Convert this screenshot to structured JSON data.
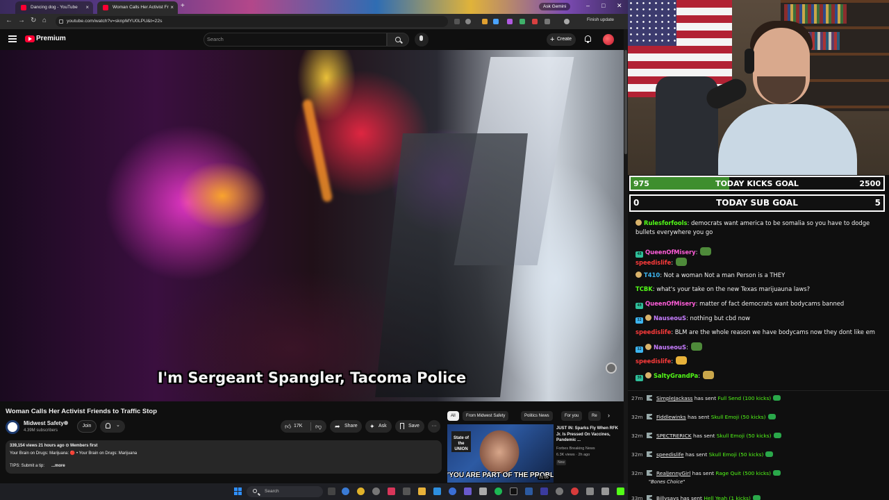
{
  "browser": {
    "tabs": [
      {
        "label": "Dancing dog - YouTube"
      },
      {
        "label": "Woman Calls Her Activist Fr"
      }
    ],
    "ask_gemini": "Ask Gemini",
    "url": "youtube.com/watch?v=sknpMYU0LPU&t=22s",
    "finish_update": "Finish update"
  },
  "youtube": {
    "logo_text": "Premium",
    "search_placeholder": "Search",
    "create_label": "Create",
    "subtitle": "I'm Sergeant Spangler, Tacoma Police",
    "video_title": "Woman Calls Her Activist Friends to Traffic Stop",
    "channel": {
      "name": "Midwest Safety",
      "subscribers": "4.39M subscribers",
      "join_label": "Join"
    },
    "actions": {
      "likes": "17K",
      "share": "Share",
      "ask": "Ask",
      "save": "Save",
      "more": "···"
    },
    "description": {
      "stats": "339,154 views  21 hours ago  ⊙ Members first",
      "line1": "Your Brain on Drugs: Marijuana:  🔴 • Your Brain on Drugs: Marijuana",
      "line2": "TIPS: Submit a tip:",
      "more": "...more"
    },
    "chips": [
      {
        "label": "All",
        "active": true
      },
      {
        "label": "From Midwest Safety"
      },
      {
        "label": "Politics News"
      },
      {
        "label": "For you"
      },
      {
        "label": "Re"
      }
    ],
    "recommendation": {
      "thumb_logo": "State of the UNION",
      "thumb_caption": "'YOU ARE PART OF THE PROBLEM!'",
      "duration": "21:05",
      "title": "JUST IN: Sparks Fly When RFK Jr. Is Pressed On Vaccines, Pandemic ...",
      "channel": "Forbes Breaking News",
      "meta": "6.3K views · 2h ago",
      "badge": "New"
    }
  },
  "taskbar": {
    "search_label": "Search"
  },
  "stream": {
    "kicks_goal": {
      "current": "975",
      "label": "TODAY KICKS GOAL",
      "target": "2500",
      "progress": 0.39
    },
    "sub_goal": {
      "current": "0",
      "label": "TODAY SUB GOAL",
      "target": "5"
    },
    "chat": [
      {
        "user": "Rulesforfools",
        "color": "#53fc18",
        "badges": [
          "gift"
        ],
        "text": ": democrats want america to be somalia so you have to dodge bullets everywhere you go"
      },
      {
        "user": "QueenOfMisery",
        "color": "#ff5dd9",
        "badges": [
          "sub"
        ],
        "sub_months": "48",
        "text": ":",
        "emote": "pepe"
      },
      {
        "user": "speedislife",
        "color": "#ff3b3b",
        "badges": [],
        "text": ":",
        "emote": "pepe"
      },
      {
        "user": "T410",
        "color": "#3db5f0",
        "badges": [
          "gift"
        ],
        "text": ": Not a woman Not a man Person is a THEY"
      },
      {
        "user": "TCBK",
        "color": "#53fc18",
        "badges": [],
        "text": ": what's your take on the new Texas marijuauna laws?"
      },
      {
        "user": "QueenOfMisery",
        "color": "#ff5dd9",
        "badges": [
          "sub"
        ],
        "sub_months": "48",
        "text": ": matter of fact democrats want bodycams banned"
      },
      {
        "user": "NauseouS",
        "color": "#c77dff",
        "badges": [
          "sub2",
          "gift"
        ],
        "sub_months": "32",
        "text": ": nothing but cbd now"
      },
      {
        "user": "speedislife",
        "color": "#ff3b3b",
        "badges": [],
        "text": ": BLM are the whole reason we have bodycams now they dont like em"
      },
      {
        "user": "NauseouS",
        "color": "#c77dff",
        "badges": [
          "sub2",
          "gift"
        ],
        "sub_months": "32",
        "text": ":",
        "emote": "pepe"
      },
      {
        "user": "speedislife",
        "color": "#ff3b3b",
        "badges": [],
        "text": ":",
        "emote": "think"
      },
      {
        "user": "SaltyGrandPa",
        "color": "#53fc18",
        "badges": [
          "sub",
          "gift"
        ],
        "sub_months": "36",
        "text": ":",
        "emote": "sword"
      }
    ],
    "events": [
      {
        "time": "27m",
        "user": "SimpleJackass",
        "verb": "has sent",
        "item": "Full Send (100 kicks)"
      },
      {
        "time": "32m",
        "user": "Fiddlewinks",
        "verb": "has sent",
        "item": "Skull Emoji (50 kicks)"
      },
      {
        "time": "32m",
        "user": "SPECTRERICK",
        "verb": "has sent",
        "item": "Skull Emoji (50 kicks)"
      },
      {
        "time": "32m",
        "user": "speedislife",
        "verb": "has sent",
        "item": "Skull Emoji (50 kicks)"
      },
      {
        "time": "32m",
        "user": "RealJennyGirl",
        "verb": "has sent",
        "item": "Rage Quit (500 kicks)",
        "quote": "\"Bones Choice\""
      },
      {
        "time": "33m",
        "user": "Billysays",
        "verb": "has sent",
        "item": "Hell Yeah (1 kicks)"
      }
    ]
  },
  "colors": {
    "youtube_red": "#ff0033",
    "kick_green": "#53fc18",
    "goal_green": "#3e8e2e"
  }
}
